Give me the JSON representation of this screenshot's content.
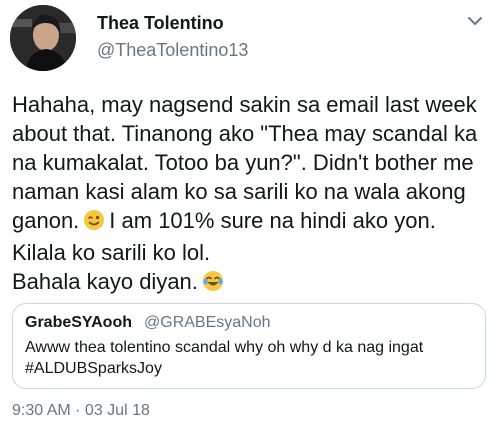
{
  "author": {
    "display_name": "Thea Tolentino",
    "handle": "@TheaTolentino13"
  },
  "tweet": {
    "lines": [
      "Hahaha, may nagsend sakin sa email last week",
      "about that. Tinanong ako \"Thea may scandal ka",
      "na kumakalat. Totoo ba yun?\". Didn't bother me",
      "naman kasi alam ko sa sarili ko na wala akong",
      "I am 101% sure na hindi ako yon.",
      "Kilala ko sarili ko lol.",
      "Bahala kayo diyan."
    ],
    "line4_prefix": "ganon.",
    "emoji_1": "winking-face-emoji",
    "emoji_2": "face-with-tears-of-joy-emoji"
  },
  "quoted_tweet": {
    "display_name": "GrabeSYAooh",
    "handle": "@GRABEsyaNoh",
    "lines": [
      "Awww thea tolentino scandal why oh why d ka nag ingat",
      "#ALDUBSparksJoy"
    ]
  },
  "timestamp": "9:30 AM · 03 Jul 18",
  "colors": {
    "text": "#14171a",
    "secondary": "#657786",
    "border": "#ccd6dd",
    "emoji": "#f7c740"
  },
  "icons": {
    "menu": "chevron-down-icon"
  }
}
